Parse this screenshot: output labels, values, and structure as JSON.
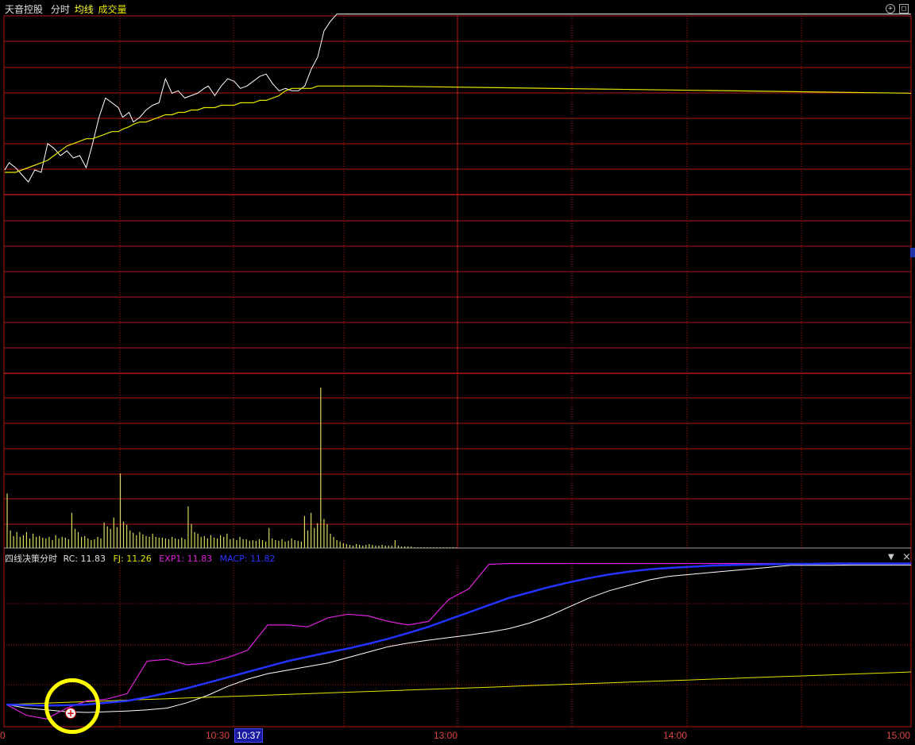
{
  "header": {
    "stock_name": "天音控股",
    "mode_label": "分时",
    "avg_label": "均线",
    "volume_label": "成交量"
  },
  "indicator": {
    "name": "四线决策分时",
    "rc_label": "RC:",
    "rc_value": "11.83",
    "fj_label": "FJ:",
    "fj_value": "11.26",
    "exp1_label": "EXP1:",
    "exp1_value": "11.83",
    "macp_label": "MACP:",
    "macp_value": "11.82"
  },
  "controls": {
    "top_right_1": "+",
    "top_right_2": "□",
    "panel_dropdown": "▼",
    "panel_close": "×"
  },
  "time_axis": {
    "labels": [
      "0",
      "10:30",
      "10:37",
      "13:00",
      "14:00",
      "15:00"
    ],
    "cursor_time": "10:37"
  },
  "colors": {
    "grid": "#b01818",
    "price": "#ffffff",
    "avg": "#e6e600",
    "volume": "#d8d860",
    "rc": "#ffffff",
    "fj": "#e6e600",
    "exp1": "#dd22dd",
    "macp": "#2233ff",
    "marker_ring": "#ffff00",
    "cursor_bg": "#1a1aa0"
  },
  "markers": [
    {
      "type": "buy-signal",
      "icon": "plus-circle-icon"
    }
  ],
  "chart_data": [
    {
      "type": "line",
      "name": "intraday-price",
      "x": [
        0,
        2,
        5,
        8,
        11,
        14,
        17,
        20,
        23,
        26,
        29,
        32,
        35,
        38,
        41,
        44,
        47,
        50,
        53,
        55,
        58,
        60,
        63,
        66,
        69,
        72,
        75,
        78,
        81,
        84,
        87,
        90,
        93,
        95,
        98,
        101,
        104,
        107,
        110,
        113,
        116,
        119,
        122,
        125,
        128,
        131,
        134,
        137,
        140,
        143,
        146,
        149,
        152,
        155,
        158,
        161,
        164,
        166,
        168,
        170,
        172
      ],
      "series": [
        {
          "label": "price",
          "values": [
            0.0,
            0.3,
            0.1,
            -0.2,
            -0.5,
            0.0,
            -0.1,
            1.1,
            0.9,
            0.6,
            0.8,
            0.5,
            0.6,
            0.1,
            1.1,
            2.2,
            3.0,
            2.8,
            2.6,
            2.2,
            2.4,
            2.0,
            2.2,
            2.5,
            2.7,
            2.8,
            3.8,
            3.2,
            3.3,
            3.0,
            3.1,
            3.2,
            3.4,
            3.5,
            3.1,
            3.5,
            3.8,
            3.7,
            3.4,
            3.5,
            3.7,
            3.9,
            4.0,
            3.6,
            3.3,
            3.4,
            3.3,
            3.3,
            3.5,
            4.2,
            4.7,
            5.8,
            6.2,
            6.5,
            6.5,
            6.5,
            6.5,
            6.5,
            6.5,
            6.5,
            6.5
          ]
        },
        {
          "label": "avg",
          "values": [
            -0.1,
            -0.1,
            -0.1,
            0.0,
            0.1,
            0.2,
            0.3,
            0.4,
            0.6,
            0.8,
            1.0,
            1.1,
            1.2,
            1.3,
            1.3,
            1.4,
            1.5,
            1.6,
            1.6,
            1.7,
            1.8,
            1.9,
            2.0,
            2.0,
            2.1,
            2.2,
            2.3,
            2.3,
            2.4,
            2.4,
            2.5,
            2.5,
            2.6,
            2.6,
            2.6,
            2.7,
            2.7,
            2.7,
            2.8,
            2.8,
            2.8,
            2.9,
            2.9,
            3.0,
            3.1,
            3.3,
            3.4,
            3.4,
            3.4,
            3.4,
            3.5,
            3.5,
            3.5,
            3.5,
            3.5,
            3.5,
            3.5,
            3.5,
            3.5,
            3.5,
            3.5
          ]
        }
      ]
    },
    {
      "type": "bar",
      "name": "volume",
      "values": [
        68,
        22,
        15,
        20,
        14,
        16,
        20,
        12,
        18,
        14,
        15,
        13,
        12,
        14,
        10,
        16,
        12,
        14,
        13,
        11,
        44,
        24,
        20,
        14,
        15,
        12,
        10,
        11,
        14,
        12,
        32,
        27,
        24,
        38,
        26,
        93,
        33,
        29,
        22,
        19,
        16,
        20,
        17,
        15,
        14,
        18,
        14,
        13,
        13,
        12,
        11,
        14,
        12,
        11,
        13,
        11,
        52,
        30,
        20,
        18,
        14,
        15,
        12,
        16,
        13,
        12,
        16,
        14,
        18,
        11,
        12,
        10,
        14,
        11,
        11,
        9,
        10,
        9,
        11,
        10,
        8,
        25,
        12,
        10,
        9,
        11,
        8,
        9,
        12,
        10,
        9,
        8,
        40,
        22,
        44,
        25,
        31,
        200,
        36,
        30,
        18,
        14,
        10,
        8,
        6,
        5,
        4,
        3,
        5,
        4,
        3,
        4,
        5,
        4,
        3,
        3,
        4,
        3,
        3,
        3,
        10,
        3,
        2,
        2,
        2,
        2,
        1,
        1,
        1,
        1,
        1,
        1,
        1,
        1,
        1,
        1,
        1,
        1,
        1,
        1
      ]
    },
    {
      "type": "line",
      "name": "four-line-decision",
      "series": [
        {
          "label": "RC",
          "values": [
            0.0,
            -0.1,
            -0.15,
            -0.2,
            -0.22,
            -0.2,
            -0.18,
            -0.15,
            -0.1,
            0.05,
            0.25,
            0.5,
            0.7,
            0.85,
            0.95,
            1.05,
            1.15,
            1.3,
            1.45,
            1.6,
            1.7,
            1.78,
            1.85,
            1.92,
            2.0,
            2.1,
            2.25,
            2.45,
            2.7,
            2.95,
            3.15,
            3.3,
            3.45,
            3.55,
            3.6,
            3.65,
            3.7,
            3.75,
            3.8,
            3.85,
            3.85,
            3.85,
            3.86,
            3.86,
            3.86,
            3.86
          ]
        },
        {
          "label": "FJ",
          "values": [
            0.0,
            0.02,
            0.04,
            0.06,
            0.08,
            0.1,
            0.12,
            0.14,
            0.16,
            0.18,
            0.2,
            0.22,
            0.24,
            0.26,
            0.28,
            0.3,
            0.32,
            0.34,
            0.36,
            0.38,
            0.4,
            0.42,
            0.44,
            0.46,
            0.48,
            0.5,
            0.52,
            0.54,
            0.56,
            0.58,
            0.6,
            0.62,
            0.64,
            0.66,
            0.68,
            0.7,
            0.72,
            0.74,
            0.76,
            0.78,
            0.8,
            0.82,
            0.84,
            0.86,
            0.88,
            0.9
          ]
        },
        {
          "label": "EXP1",
          "values": [
            0.0,
            -0.3,
            -0.4,
            -0.1,
            0.1,
            0.15,
            0.3,
            1.2,
            1.25,
            1.1,
            1.15,
            1.3,
            1.5,
            2.2,
            2.2,
            2.15,
            2.4,
            2.5,
            2.45,
            2.3,
            2.2,
            2.3,
            2.9,
            3.2,
            3.88,
            3.9,
            3.9,
            3.9,
            3.9,
            3.9,
            3.9,
            3.9,
            3.9,
            3.9,
            3.9,
            3.9,
            3.9,
            3.9,
            3.9,
            3.9,
            3.9,
            3.9,
            3.9,
            3.9,
            3.9,
            3.9
          ]
        },
        {
          "label": "MACP",
          "values": [
            0.0,
            -0.02,
            -0.03,
            -0.02,
            0.0,
            0.05,
            0.1,
            0.2,
            0.32,
            0.45,
            0.6,
            0.75,
            0.9,
            1.05,
            1.2,
            1.32,
            1.44,
            1.55,
            1.68,
            1.82,
            1.98,
            2.15,
            2.35,
            2.55,
            2.75,
            2.95,
            3.1,
            3.25,
            3.38,
            3.5,
            3.6,
            3.68,
            3.74,
            3.78,
            3.81,
            3.84,
            3.86,
            3.87,
            3.88,
            3.89,
            3.89,
            3.9,
            3.9,
            3.9,
            3.9,
            3.9
          ]
        }
      ]
    }
  ]
}
